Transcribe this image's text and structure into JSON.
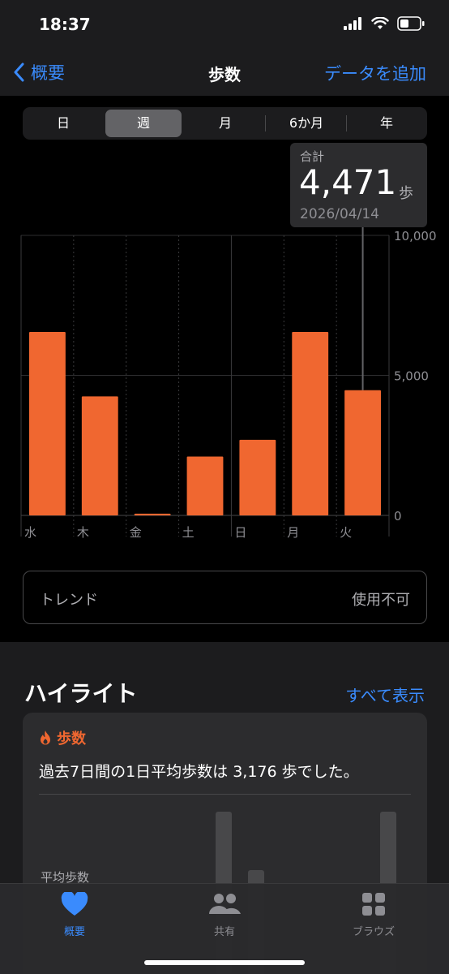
{
  "status": {
    "time": "18:37"
  },
  "nav": {
    "back_label": "概要",
    "title": "歩数",
    "add_label": "データを追加"
  },
  "segments": [
    "日",
    "週",
    "月",
    "6か月",
    "年"
  ],
  "segments_active": "週",
  "tooltip": {
    "label": "合計",
    "value": "4,471",
    "unit": "歩",
    "date": "2026/04/14"
  },
  "chart_data": {
    "type": "bar",
    "categories": [
      "水",
      "木",
      "金",
      "土",
      "日",
      "月",
      "火"
    ],
    "values": [
      6550,
      4250,
      60,
      2100,
      2700,
      6550,
      4471
    ],
    "ylim": [
      0,
      10000
    ],
    "yticks": [
      "10,000",
      "5,000",
      "0"
    ],
    "color": "#f06730",
    "selected_index": 6
  },
  "trend": {
    "label": "トレンド",
    "value": "使用不可"
  },
  "highlights": {
    "title": "ハイライト",
    "show_all": "すべて表示",
    "card_category": "歩数",
    "card_text": "過去7日間の1日平均歩数は 3,176 歩でした。",
    "avg_label": "平均歩数"
  },
  "tabs": [
    {
      "label": "概要",
      "icon": "heart-icon",
      "active": true
    },
    {
      "label": "共有",
      "icon": "people-icon",
      "active": false
    },
    {
      "label": "ブラウズ",
      "icon": "grid-icon",
      "active": false
    }
  ],
  "colors": {
    "accent": "#3a8bfd",
    "bar": "#f06730",
    "background": "#000000"
  }
}
